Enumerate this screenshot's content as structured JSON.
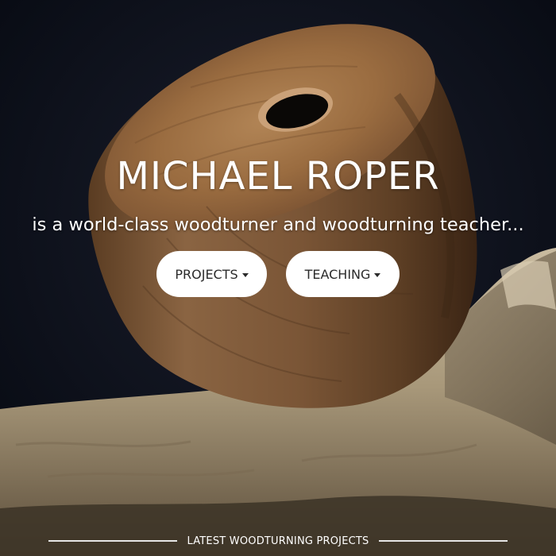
{
  "hero": {
    "title": "MICHAEL ROPER",
    "tagline": "is a world-class woodturner and woodturning teacher..."
  },
  "nav_buttons": {
    "projects_label": "PROJECTS",
    "teaching_label": "TEACHING"
  },
  "latest_section": {
    "label": "LATEST WOODTURNING PROJECTS"
  },
  "icons": {
    "dropdown": "caret-down-icon"
  },
  "colors": {
    "background": "#0a0d16",
    "button_bg": "#ffffff",
    "button_text": "#2b2b2b",
    "text": "#ffffff"
  }
}
